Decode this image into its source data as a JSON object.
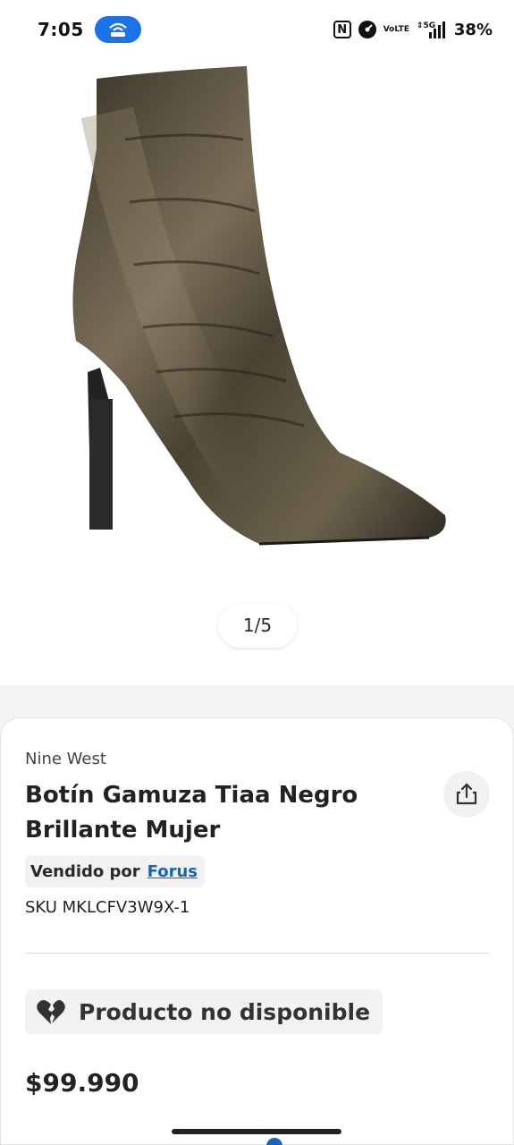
{
  "status_bar": {
    "time": "7:05",
    "network": "5G",
    "volte_top": "Vo",
    "volte_bottom": "LTE",
    "nfc": "N",
    "battery": "38%",
    "icons": [
      "hotspot-icon",
      "nfc-icon",
      "data-saver-icon",
      "volte-icon",
      "signal-icon"
    ],
    "accent_color": "#1a73e8"
  },
  "gallery": {
    "counter": "1/5",
    "image_alt": "metallic pointed stiletto ankle boot"
  },
  "product": {
    "brand": "Nine West",
    "title": "Botín Gamuza Tiaa Negro Brillante Mujer",
    "seller_prefix": "Vendido por",
    "seller_name": "Forus",
    "sku": "SKU MKLCFV3W9X-1",
    "availability": "Producto no disponible",
    "price": "$99.990",
    "link_color": "#1565c0"
  }
}
